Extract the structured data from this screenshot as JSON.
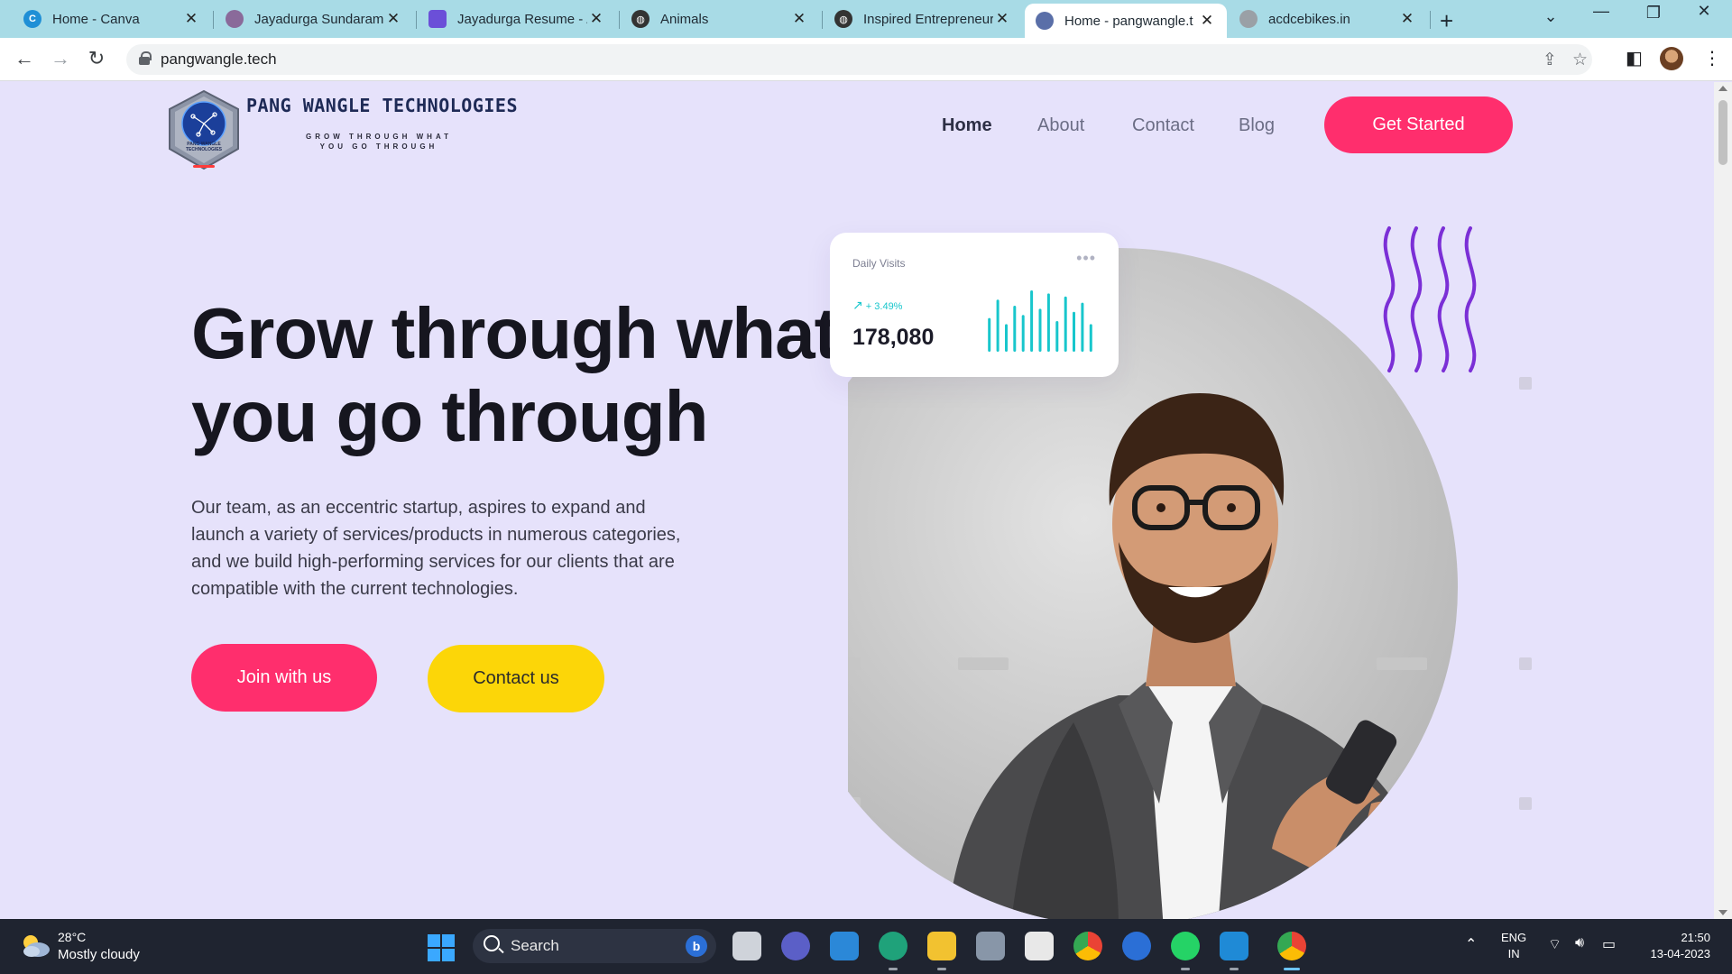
{
  "browser": {
    "tabs": [
      {
        "title": "Home - Canva",
        "favicon": "canva-icon",
        "color": "#1f8fd6"
      },
      {
        "title": "Jayadurga Sundaram",
        "favicon": "profile-icon",
        "color": "#8a6a9a"
      },
      {
        "title": "Jayadurga Resume - /",
        "favicon": "document-icon",
        "color": "#6b4fd8"
      },
      {
        "title": "Animals",
        "favicon": "globe-icon",
        "color": "#333333"
      },
      {
        "title": "Inspired Entrepreneur",
        "favicon": "globe-icon",
        "color": "#333333"
      },
      {
        "title": "Home - pangwangle.t",
        "favicon": "pangwangle-icon",
        "color": "#5a6fa8",
        "active": true
      },
      {
        "title": "acdcebikes.in",
        "favicon": "loading-icon",
        "color": "#9aa0a6"
      }
    ],
    "new_tab_label": "+",
    "url": "pangwangle.tech"
  },
  "site": {
    "brand": {
      "name": "PANG WANGLE TECHNOLOGIES",
      "tagline_line1": "GROW THROUGH WHAT",
      "tagline_line2": "YOU GO THROUGH",
      "badge_text_line1": "PANG WANGLE",
      "badge_text_line2": "TECHNOLOGIES"
    },
    "nav": {
      "home": "Home",
      "about": "About",
      "contact": "Contact",
      "blog": "Blog",
      "cta": "Get Started"
    },
    "hero": {
      "title_line1": "Grow through what",
      "title_line2": "you go through",
      "description_lines": [
        "Our team, as an eccentric startup, aspires to expand and",
        "launch a variety of services/products in numerous categories,",
        "and we build high-performing services for our clients that are",
        "compatible with the current technologies."
      ],
      "join_label": "Join with us",
      "contact_label": "Contact us"
    },
    "stats_card": {
      "title": "Daily Visits",
      "more": "•••",
      "change": "+ 3.49%",
      "value": "178,080",
      "bar_heights": [
        0.55,
        0.85,
        0.45,
        0.75,
        0.6,
        1.0,
        0.7,
        0.95,
        0.5,
        0.9,
        0.65,
        0.8,
        0.45
      ]
    },
    "colors": {
      "page_bg": "#e6e2fb",
      "primary": "#ff2e6d",
      "secondary": "#fcd608",
      "chart": "#18c6cc",
      "squiggle": "#7b2fd6"
    }
  },
  "taskbar": {
    "weather_temp": "28°C",
    "weather_desc": "Mostly cloudy",
    "search_label": "Search",
    "lang_line1": "ENG",
    "lang_line2": "IN",
    "time": "21:50",
    "date": "13-04-2023"
  }
}
